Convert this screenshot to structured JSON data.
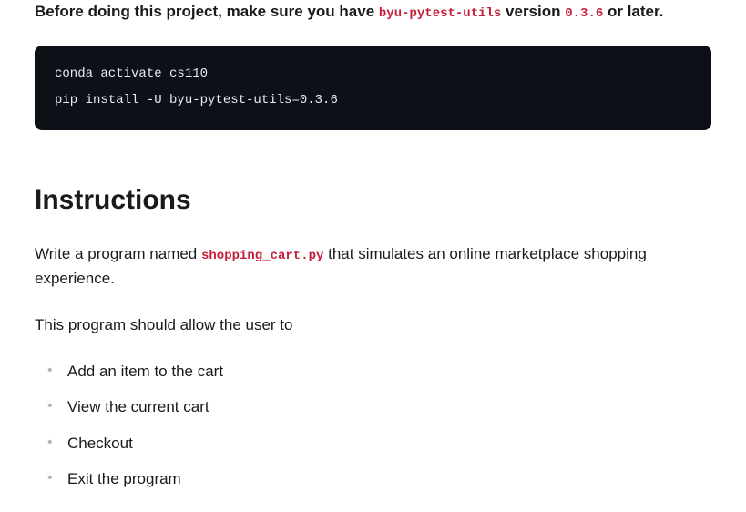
{
  "intro": {
    "prefix": "Before doing this project, make sure you have ",
    "package": "byu-pytest-utils",
    "middle": " version ",
    "version": "0.3.6",
    "suffix": " or later."
  },
  "code_block": "conda activate cs110\npip install -U byu-pytest-utils=0.3.6",
  "heading": "Instructions",
  "para1": {
    "prefix": "Write a program named ",
    "filename": "shopping_cart.py",
    "suffix": " that simulates an online marketplace shopping experience."
  },
  "para2": "This program should allow the user to",
  "list": [
    "Add an item to the cart",
    "View the current cart",
    "Checkout",
    "Exit the program"
  ]
}
